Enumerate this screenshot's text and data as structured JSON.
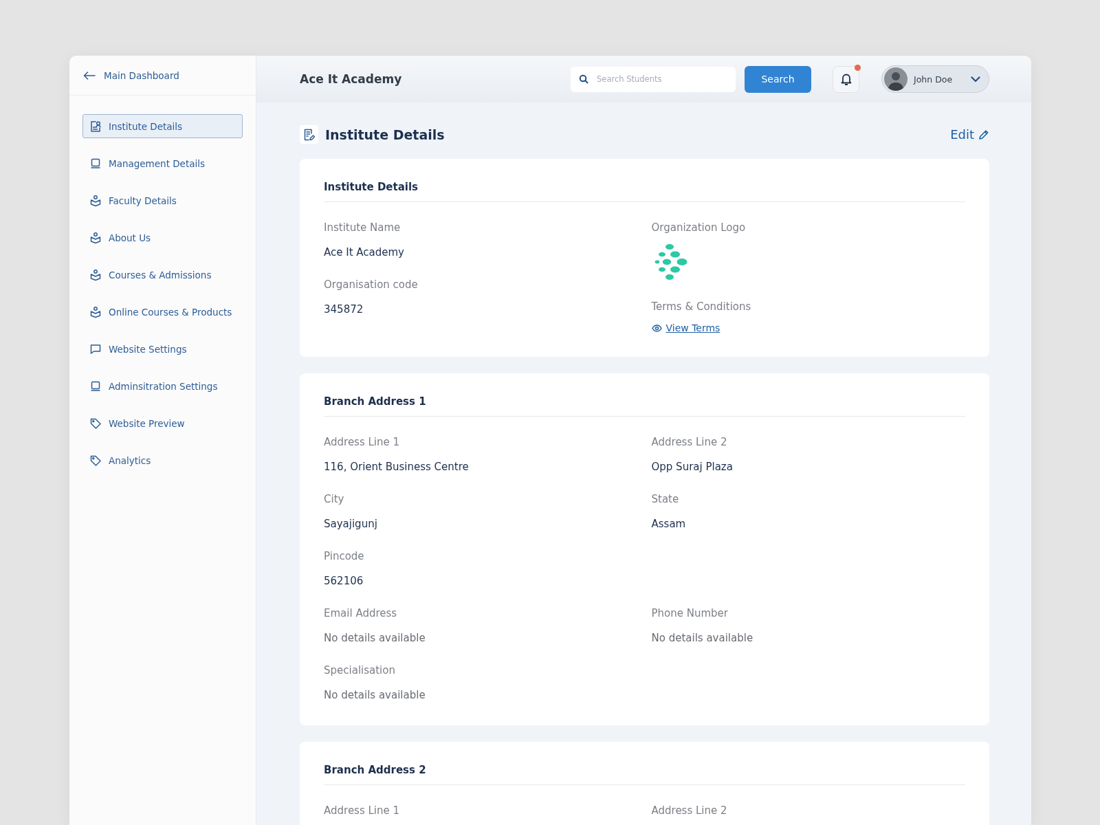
{
  "sidebar": {
    "back": {
      "label": "Main Dashboard"
    },
    "items": [
      {
        "label": "Institute Details",
        "kind": "document",
        "selected": true
      },
      {
        "label": "Management Details",
        "kind": "laptop",
        "selected": false
      },
      {
        "label": "Faculty Details",
        "kind": "reader",
        "selected": false
      },
      {
        "label": "About Us",
        "kind": "reader",
        "selected": false
      },
      {
        "label": "Courses & Admissions",
        "kind": "reader",
        "selected": false
      },
      {
        "label": "Online Courses & Products",
        "kind": "reader",
        "selected": false
      },
      {
        "label": "Website Settings",
        "kind": "chat",
        "selected": false
      },
      {
        "label": "Adminsitration Settings",
        "kind": "laptop",
        "selected": false
      },
      {
        "label": "Website Preview",
        "kind": "tag",
        "selected": false
      },
      {
        "label": "Analytics",
        "kind": "tag",
        "selected": false
      }
    ]
  },
  "header": {
    "title": "Ace It Academy",
    "search": {
      "placeholder": "Search Students"
    },
    "search_button": "Search",
    "notifications": {
      "unread": true
    },
    "user": {
      "name": "John Doe"
    }
  },
  "page": {
    "title": "Institute Details",
    "edit": "Edit"
  },
  "sections": [
    {
      "title": "Institute Details",
      "columns": [
        [
          {
            "kind": "text",
            "label": "Institute Name",
            "value": "Ace It Academy"
          },
          {
            "kind": "text",
            "label": "Organisation code",
            "value": "345872"
          }
        ],
        [
          {
            "kind": "logo",
            "label": "Organization Logo"
          },
          {
            "kind": "link",
            "label": "Terms & Conditions",
            "value": "View Terms"
          }
        ]
      ]
    },
    {
      "title": "Branch Address 1",
      "rows": [
        [
          {
            "kind": "text",
            "label": "Address Line 1",
            "value": "116, Orient Business Centre"
          },
          {
            "kind": "text",
            "label": "Address Line 2",
            "value": "Opp Suraj Plaza"
          }
        ],
        [
          {
            "kind": "text",
            "label": "City",
            "value": "Sayajigunj"
          },
          {
            "kind": "text",
            "label": "State",
            "value": "Assam"
          }
        ],
        [
          {
            "kind": "text",
            "label": "Pincode",
            "value": "562106"
          }
        ],
        [
          {
            "kind": "empty",
            "label": "Email Address",
            "value": "No details available"
          },
          {
            "kind": "empty",
            "label": "Phone Number",
            "value": "No details available"
          }
        ],
        [
          {
            "kind": "empty",
            "label": "Specialisation",
            "value": "No details available"
          }
        ]
      ]
    },
    {
      "title": "Branch Address 2",
      "rows": [
        [
          {
            "kind": "text",
            "label": "Address Line 1"
          },
          {
            "kind": "text",
            "label": "Address Line 2"
          }
        ]
      ]
    }
  ]
}
